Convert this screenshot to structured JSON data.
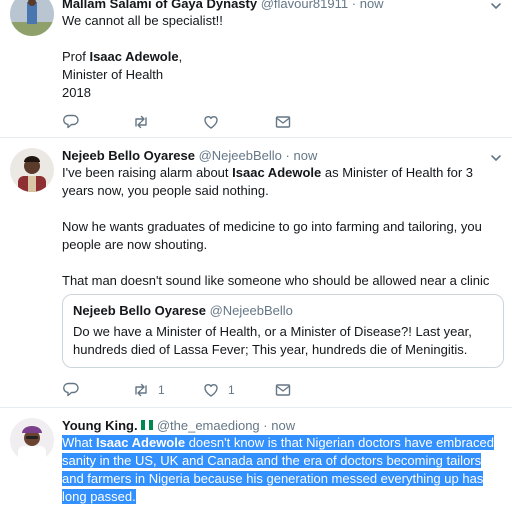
{
  "tweets": [
    {
      "name": "Mallam Salami of Gaya Dynasty",
      "handle": "@flavour81911",
      "sep": "·",
      "time": "now",
      "lines": [
        "We cannot all be specialist!!",
        "Prof ",
        "Isaac Adewole",
        ",",
        "Minister of Health",
        "2018"
      ],
      "reply_count": "",
      "retweet_count": "",
      "like_count": ""
    },
    {
      "name": "Nejeeb Bello Oyarese",
      "handle": "@NejeebBello",
      "sep": "·",
      "time": "now",
      "p1_a": "I've been raising alarm about ",
      "p1_b": "Isaac Adewole",
      "p1_c": " as Minister of Health for 3 years now, you people said nothing.",
      "p2": "Now he wants graduates of medicine to go into farming and tailoring, you people are now shouting.",
      "p3": "That man doesn't sound like someone who should be allowed near a clinic",
      "quote": {
        "name": "Nejeeb Bello Oyarese",
        "handle": "@NejeebBello",
        "text": "Do we have a Minister of Health, or a Minister of Disease?! Last year, hundreds died of Lassa Fever; This year, hundreds die of Meningitis."
      },
      "retweet_count": "1",
      "like_count": "1"
    },
    {
      "name": "Young King.",
      "handle": "@the_emaediong",
      "sep": "·",
      "time": "now",
      "t_a": "What ",
      "t_b": "Isaac Adewole",
      "t_c": " doesn't know is that Nigerian doctors have embraced sanity in the US, UK and Canada and the era of doctors becoming tailors and farmers in Nigeria because his generation messed everything up has long passed."
    }
  ],
  "icons": [
    "reply-icon",
    "retweet-icon",
    "like-icon",
    "caret-down-icon",
    "nigeria-flag-icon"
  ],
  "colors": {
    "text": "#14171a",
    "meta": "#657786",
    "selection": "#3390ff",
    "divider": "#e6ecf0",
    "flag_green": "#008751"
  }
}
